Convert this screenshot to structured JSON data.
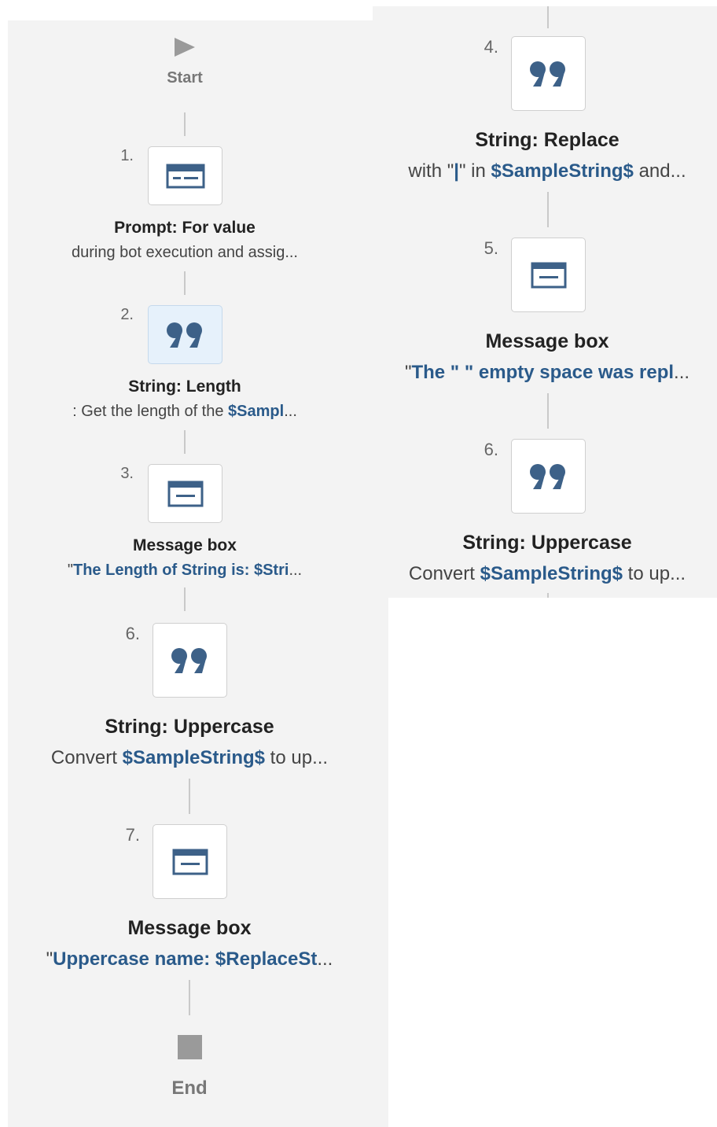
{
  "start_label": "Start",
  "end_label": "End",
  "steps_left": [
    {
      "number": "1.",
      "title": "Prompt: For value",
      "desc_parts": [
        {
          "t": "during bot execution and assig...",
          "v": false
        }
      ],
      "icon": "prompt-form-icon"
    },
    {
      "number": "2.",
      "title": "String: Length",
      "desc_parts": [
        {
          "t": ": Get the length of the ",
          "v": false
        },
        {
          "t": "$Sampl",
          "v": true
        },
        {
          "t": "...",
          "v": false
        }
      ],
      "icon": "quote-icon"
    },
    {
      "number": "3.",
      "title": "Message box",
      "desc_parts": [
        {
          "t": "\"",
          "v": false
        },
        {
          "t": "The Length of String is: $Stri",
          "v": true
        },
        {
          "t": "...",
          "v": false
        }
      ],
      "icon": "message-box-icon"
    },
    {
      "number": "6.",
      "title": "String: Uppercase",
      "desc_parts": [
        {
          "t": "Convert ",
          "v": false
        },
        {
          "t": "$SampleString$",
          "v": true
        },
        {
          "t": " to up...",
          "v": false
        }
      ],
      "icon": "quote-icon"
    },
    {
      "number": "7.",
      "title": "Message box",
      "desc_parts": [
        {
          "t": "\"",
          "v": false
        },
        {
          "t": "Uppercase name: $ReplaceSt",
          "v": true
        },
        {
          "t": "...",
          "v": false
        }
      ],
      "icon": "message-box-icon"
    }
  ],
  "steps_right": [
    {
      "number": "4.",
      "title": "String: Replace",
      "desc_parts": [
        {
          "t": "with \"",
          "v": false
        },
        {
          "t": "|",
          "v": true
        },
        {
          "t": "\" in ",
          "v": false
        },
        {
          "t": "$SampleString$",
          "v": true
        },
        {
          "t": " and...",
          "v": false
        }
      ],
      "icon": "quote-icon"
    },
    {
      "number": "5.",
      "title": "Message box",
      "desc_parts": [
        {
          "t": "\"",
          "v": false
        },
        {
          "t": "The \" \" empty space was repl",
          "v": true
        },
        {
          "t": "...",
          "v": false
        }
      ],
      "icon": "message-box-icon"
    },
    {
      "number": "6.",
      "title": "String: Uppercase",
      "desc_parts": [
        {
          "t": "Convert ",
          "v": false
        },
        {
          "t": "$SampleString$",
          "v": true
        },
        {
          "t": " to up...",
          "v": false
        }
      ],
      "icon": "quote-icon"
    }
  ],
  "colors": {
    "variable": "#2a5a8a",
    "icon": "#3d6188",
    "connector": "#c9c9c9",
    "selected": "#e6f1fb"
  }
}
